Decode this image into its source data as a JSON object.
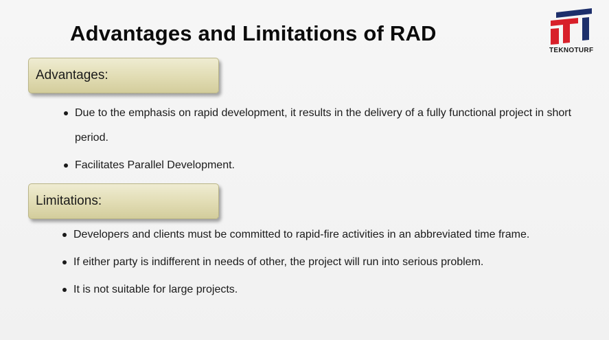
{
  "slide": {
    "title": "Advantages and Limitations of RAD",
    "logo": {
      "icon": "teknoturf-logo-icon",
      "text": "TEKNOTURF",
      "colors": {
        "red": "#d8202a",
        "navy": "#1d2f6b"
      }
    },
    "sections": [
      {
        "heading": "Advantages:",
        "bullets": [
          "Due to the emphasis on rapid development, it results in the delivery of a fully functional project in short  period.",
          "Facilitates Parallel Development."
        ]
      },
      {
        "heading": "Limitations:",
        "bullets": [
          "Developers and clients must be committed to rapid-fire activities in an abbreviated time frame.",
          "If either party is indifferent in needs of other, the project will run into serious problem.",
          "It is not suitable for  large projects."
        ]
      }
    ],
    "colors": {
      "box_fill": "#e1dcb3",
      "box_border": "#b9b486",
      "background": "#f4f4f4"
    }
  }
}
